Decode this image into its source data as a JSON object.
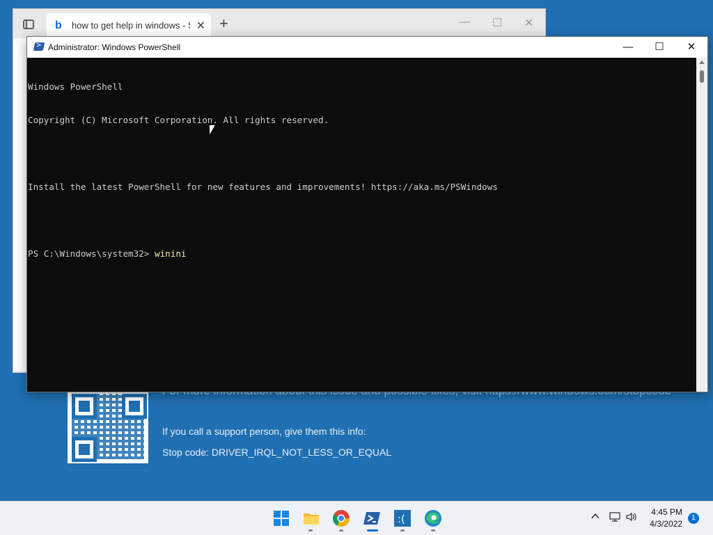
{
  "desktop": {
    "bsod_info_line": "For more information about this issue and possible fixes, visit https://www.windows.com/stopcode",
    "bsod_support_line": "If you call a support person, give them this info:",
    "bsod_stop_code": "Stop code: DRIVER_IRQL_NOT_LESS_OR_EQUAL"
  },
  "browser": {
    "tab_title": "how to get help in windows - Se",
    "tab_close": "✕",
    "new_tab": "+",
    "minimize": "—",
    "maximize": "☐",
    "close": "✕"
  },
  "powershell": {
    "window_title": "Administrator: Windows PowerShell",
    "minimize": "—",
    "maximize": "☐",
    "close": "✕",
    "console_lines": [
      "Windows PowerShell",
      "Copyright (C) Microsoft Corporation. All rights reserved.",
      "",
      "Install the latest PowerShell for new features and improvements! https://aka.ms/PSWindows",
      ""
    ],
    "prompt": "PS C:\\Windows\\system32> ",
    "command": "winini"
  },
  "taskbar": {
    "apps": [
      {
        "name": "start-icon"
      },
      {
        "name": "file-explorer-icon"
      },
      {
        "name": "chrome-icon"
      },
      {
        "name": "powershell-icon",
        "active": true
      },
      {
        "name": "bsod-app-icon"
      },
      {
        "name": "edge-icon"
      }
    ],
    "tray_chevron": "^",
    "time": "4:45 PM",
    "date": "4/3/2022",
    "notifications": "1"
  },
  "colors": {
    "desktop_bg": "#1f6fb2",
    "console_bg": "#0c0c0c",
    "console_text": "#cccccc",
    "command_text": "#f9f1a5",
    "accent": "#0a6fd1"
  }
}
